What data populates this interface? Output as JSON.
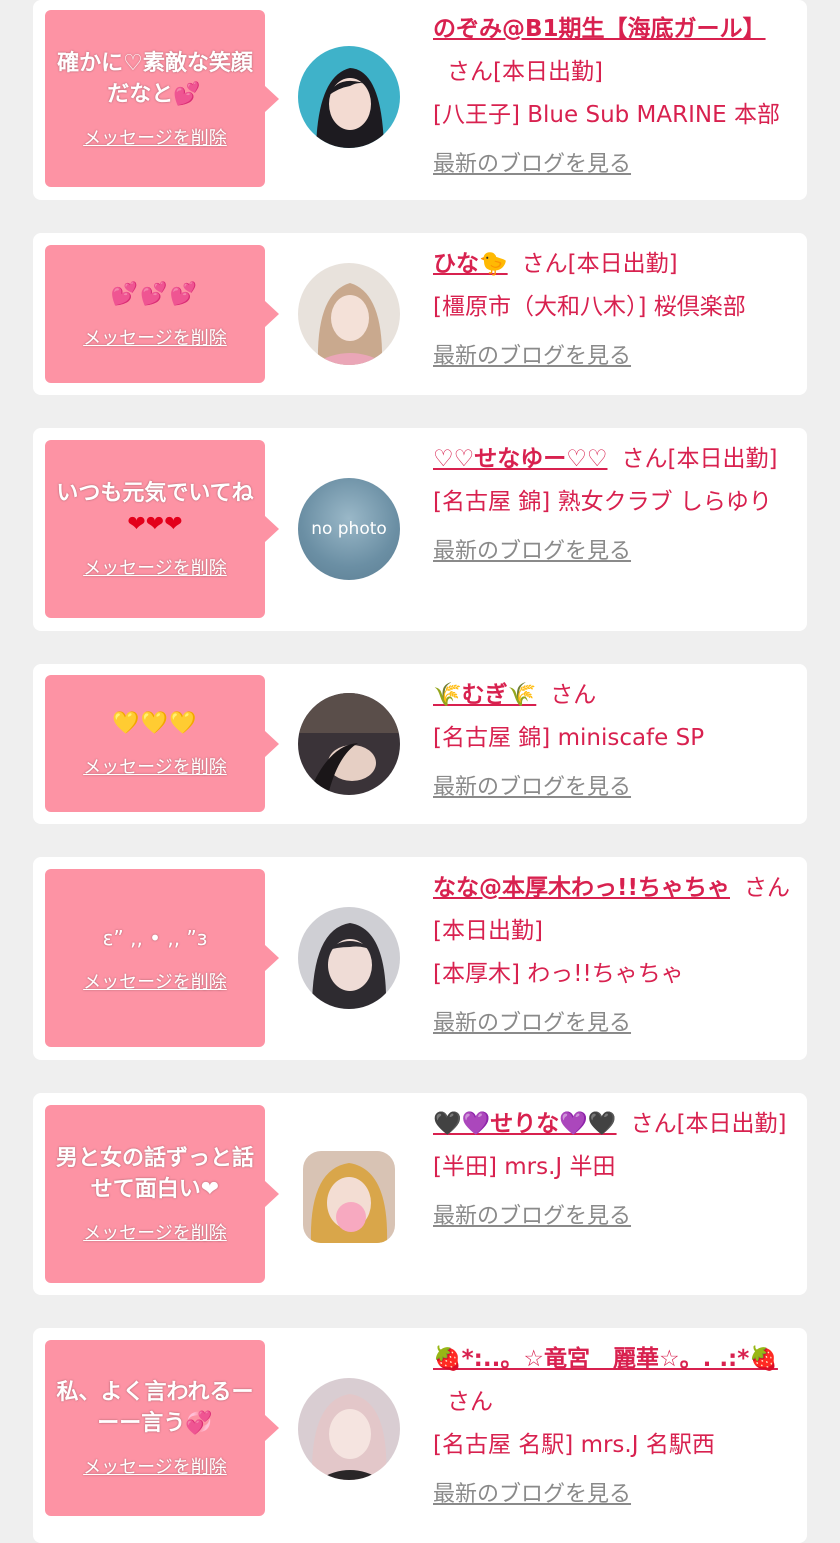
{
  "delete_label": "メッセージを削除",
  "blog_label": "最新のブログを見る",
  "suffix_san": "さん",
  "suffix_working": "[本日出勤]",
  "cards": [
    {
      "message": "確かに♡素敵な笑顔だなと",
      "message_emoji": "💕",
      "name": "のぞみ@B1期生【海底ガール】",
      "working": true,
      "shop": "[八王子] Blue Sub MARINE 本部",
      "photo": "photo"
    },
    {
      "message": "",
      "message_emoji": "💕💕💕",
      "name": "ひな🐤",
      "working": true,
      "shop": "[橿原市（大和八木）] 桜倶楽部",
      "photo": "photo"
    },
    {
      "message": "いつも元気でいてね",
      "message_emoji": "❤❤❤",
      "name": "♡♡せなゆー♡♡",
      "working": true,
      "shop": "[名古屋 錦] 熟女クラブ しらゆり",
      "photo": "no photo"
    },
    {
      "message": "",
      "message_emoji": "💛💛💛",
      "name": "🌾むぎ🌾",
      "working": false,
      "shop": "[名古屋 錦] miniscafe SP",
      "photo": "photo"
    },
    {
      "message": "ε” ,, • ,, ”з",
      "message_emoji": "",
      "name": "なな@本厚木わっ!!ちゃちゃ",
      "working": true,
      "shop": "[本厚木] わっ!!ちゃちゃ",
      "photo": "photo"
    },
    {
      "message": "男と女の話ずっと話せて面白い",
      "message_emoji": "❤",
      "name": "🖤💜せりな💜🖤",
      "working": true,
      "shop": "[半田] mrs.J 半田",
      "photo": "photo"
    },
    {
      "message": "私、よく言われるーーー言う",
      "message_emoji": "💞",
      "name": "🍓*:..。☆竜宮　麗華☆。. .:*🍓",
      "working": false,
      "shop": "[名古屋 名駅] mrs.J 名駅西",
      "photo": "photo"
    }
  ],
  "colors": {
    "background": "#efefef",
    "card": "#ffffff",
    "bubble": "#fd93a4",
    "accent": "#d8214f",
    "link_gray": "#8a8a8a"
  }
}
